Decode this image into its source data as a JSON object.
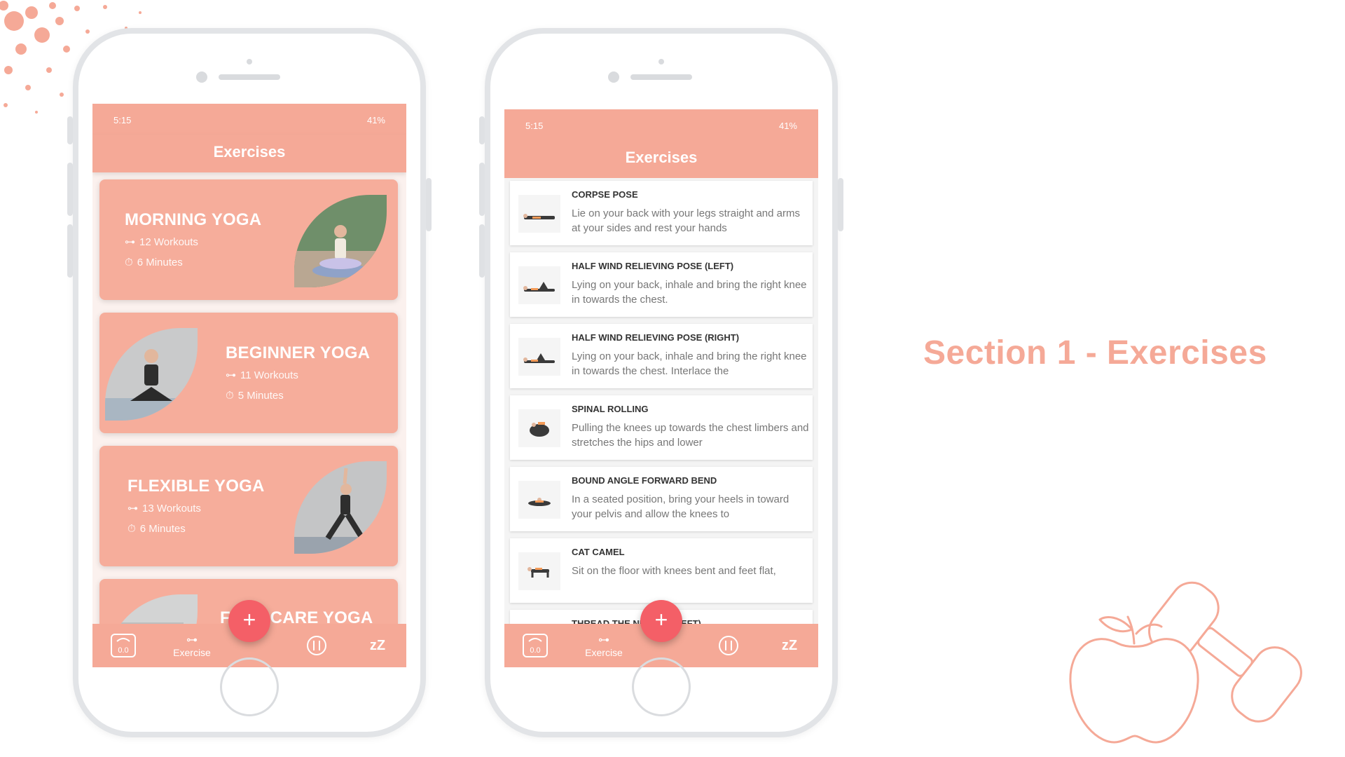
{
  "section_title": "Section 1 - Exercises",
  "colors": {
    "accent": "#f5a997",
    "card": "#f6ad9b",
    "fab": "#f45f67",
    "title_text": "#f5a997"
  },
  "left_phone": {
    "status": {
      "time": "5:15",
      "battery": "41%"
    },
    "title": "Exercises",
    "cards": [
      {
        "title": "MORNING YOGA",
        "workouts": "12 Workouts",
        "duration": "6 Minutes"
      },
      {
        "title": "BEGINNER YOGA",
        "workouts": "11 Workouts",
        "duration": "5 Minutes"
      },
      {
        "title": "FLEXIBLE YOGA",
        "workouts": "13 Workouts",
        "duration": "6 Minutes"
      },
      {
        "title": "FACE CARE YOGA"
      }
    ],
    "nav": {
      "exercise_label": "Exercise",
      "sleep_label": "zZ",
      "fab": "+"
    }
  },
  "right_phone": {
    "status": {
      "time": "5:15",
      "battery": "41%"
    },
    "title": "Exercises",
    "exercises": [
      {
        "name": "CORPSE POSE",
        "description": "Lie on your back with your legs straight and arms at your sides and rest your hands"
      },
      {
        "name": "HALF WIND RELIEVING POSE (LEFT)",
        "description": "Lying on your back, inhale and bring the right knee in towards the chest."
      },
      {
        "name": "HALF WIND RELIEVING POSE (RIGHT)",
        "description": "Lying on your back, inhale and bring the right knee in towards the chest. Interlace the"
      },
      {
        "name": "SPINAL ROLLING",
        "description": "Pulling the knees up towards the chest limbers and stretches the hips and lower"
      },
      {
        "name": "BOUND ANGLE FORWARD BEND",
        "description": "In a seated position, bring your heels in toward your pelvis and allow the knees to"
      },
      {
        "name": "CAT CAMEL",
        "description": "Sit on the floor with knees bent and feet flat,"
      },
      {
        "name": "THREAD THE NEEDLE (LEFT)",
        "description": ""
      }
    ],
    "nav": {
      "exercise_label": "Exercise",
      "sleep_label": "zZ",
      "fab": "+"
    }
  }
}
